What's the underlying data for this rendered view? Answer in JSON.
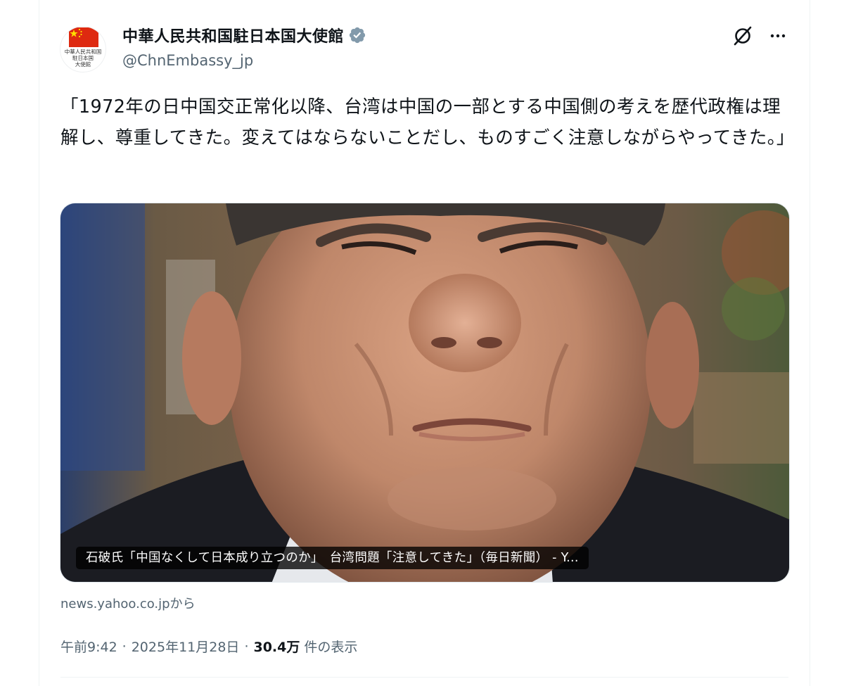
{
  "author": {
    "display_name": "中華人民共和国駐日本国大使館",
    "handle": "@ChnEmbassy_jp",
    "avatar_text": [
      "中華人民共和国",
      "駐日本国",
      "大使館"
    ],
    "verified_icon": "verified-badge-icon"
  },
  "header_actions": {
    "grok_icon": "grok-icon",
    "more_icon": "more-horizontal-icon"
  },
  "tweet": {
    "text": "「1972年の日中国交正常化以降、台湾は中国の一部とする中国側の考えを歴代政権は理解し、尊重してきた。変えてはならないことだし、ものすごく注意しながらやってきた。」"
  },
  "card": {
    "caption": "石破氏「中国なくして日本成り立つのか」　台湾問題「注意してきた」（毎日新聞） - Y...",
    "source": "news.yahoo.co.jpから"
  },
  "meta": {
    "time": "午前9:42",
    "date": "2025年11月28日",
    "separator": "·",
    "views_count": "30.4万",
    "views_label": "件の表示"
  },
  "colors": {
    "verified": "#829aab",
    "secondary_text": "#536471",
    "primary_text": "#0f1419",
    "flag_red": "#de2910",
    "flag_star": "#ffde00"
  }
}
